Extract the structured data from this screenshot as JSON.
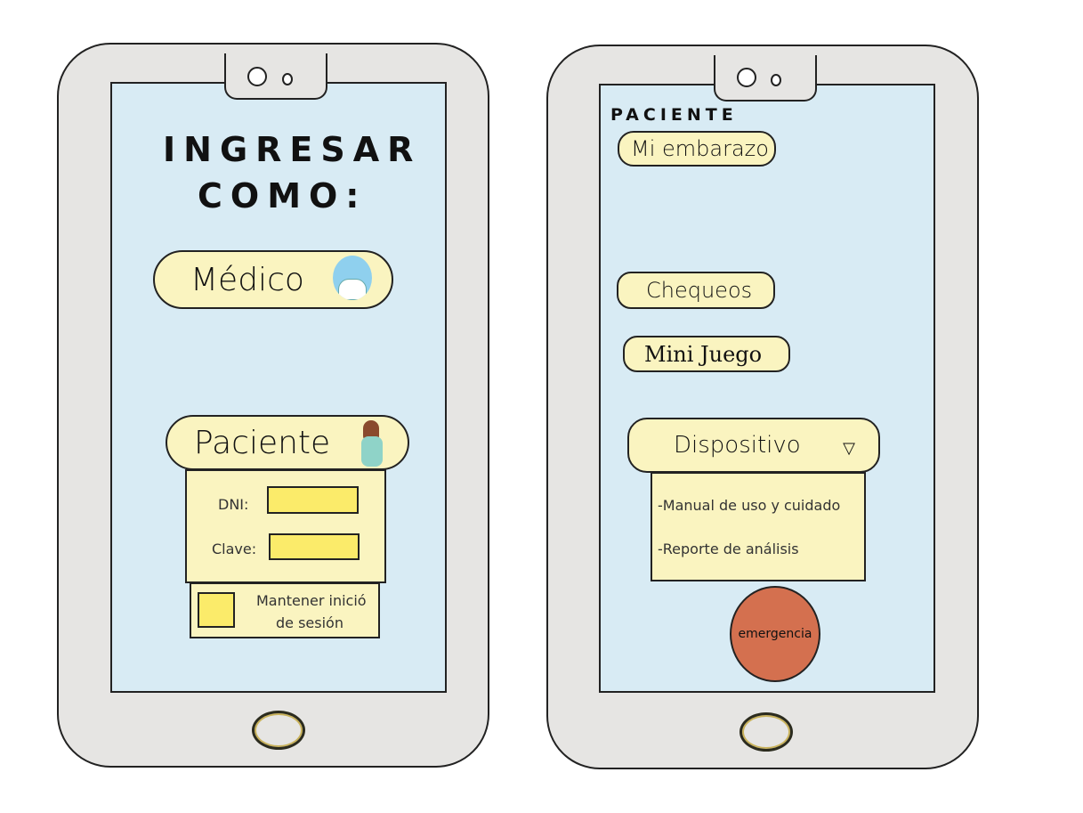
{
  "login_screen": {
    "title_line1": "INGRESAR",
    "title_line2": "COMO:",
    "medico_button": "Médico",
    "paciente_button": "Paciente",
    "dni_label": "DNI:",
    "clave_label": "Clave:",
    "keep_session_line1": "Mantener inició",
    "keep_session_line2": "de sesión"
  },
  "patient_screen": {
    "title": "PACIENTE",
    "menu": [
      "Mi embarazo",
      "Chequeos",
      "Mini Juego"
    ],
    "dropdown_label": "Dispositivo",
    "dropdown_items": [
      "-Manual de uso y cuidado",
      "-Reporte de análisis"
    ],
    "emergency_button": "emergencia"
  },
  "colors": {
    "screen": "#d8ebf4",
    "pill": "#faf4c0",
    "input": "#fbeb6a",
    "emergency": "#d4704f"
  }
}
